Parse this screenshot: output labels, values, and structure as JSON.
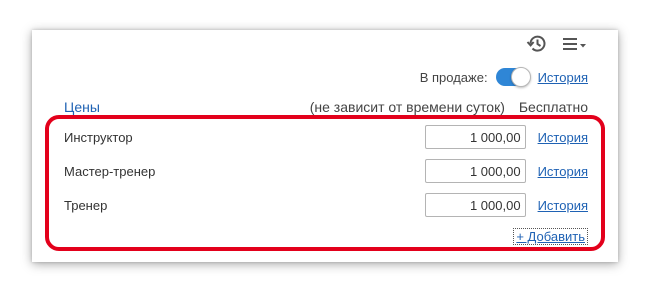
{
  "header": {
    "history_icon": "history-clock-icon",
    "menu_icon": "menu-list-icon"
  },
  "sale": {
    "label": "В продаже:",
    "enabled": true,
    "history_link": "История"
  },
  "prices": {
    "title": "Цены",
    "note": "(не зависит от времени суток)",
    "free_label": "Бесплатно",
    "rows": [
      {
        "name": "Инструктор",
        "value": "1 000,00",
        "history_link": "История"
      },
      {
        "name": "Мастер-тренер",
        "value": "1 000,00",
        "history_link": "История"
      },
      {
        "name": "Тренер",
        "value": "1 000,00",
        "history_link": "История"
      }
    ],
    "add_link": "+ Добавить"
  },
  "colors": {
    "accent": "#2f86d6",
    "link": "#1f62b4",
    "highlight": "#e3001b"
  }
}
